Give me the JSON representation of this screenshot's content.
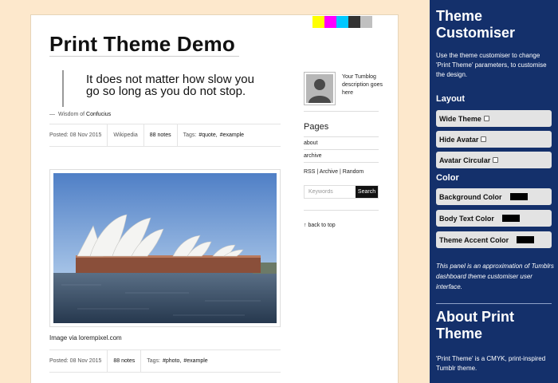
{
  "cmyk_colors": [
    "#ffff00",
    "#ff00ff",
    "#00c8ff",
    "#333333",
    "#c0c0c0"
  ],
  "site": {
    "title": "Print Theme Demo"
  },
  "post1": {
    "quote": "It does not matter how slow you go so long as you do not stop.",
    "source_prefix": "Wisdom of",
    "source_name": "Confucius",
    "posted": "Posted: 08 Nov 2015",
    "via": "Wikipedia",
    "notes": "88 notes",
    "tags_label": "Tags:",
    "tags": [
      "#quote,",
      "#example"
    ]
  },
  "post2": {
    "image_icon": "sydney-opera-house-photo",
    "caption": "Image via lorempixel.com",
    "posted": "Posted: 08 Nov 2015",
    "notes": "88 notes",
    "tags_label": "Tags:",
    "tags": [
      "#photo,",
      "#example"
    ]
  },
  "sidebar": {
    "description": "Your Tumblog description goes here",
    "pages_heading": "Pages",
    "pages": [
      "about",
      "archive"
    ],
    "util_links": [
      "RSS",
      "Archive",
      "Random"
    ],
    "search_placeholder": "Keywords",
    "search_button": "Search",
    "back_to_top": "↑ back to top"
  },
  "panel": {
    "title_line1": "Theme",
    "title_line2": "Customiser",
    "intro": "Use the theme customiser to change 'Print Theme' parameters, to customise the design.",
    "layout_heading": "Layout",
    "layout_options": [
      "Wide Theme",
      "Hide Avatar",
      "Avatar Circular"
    ],
    "color_heading": "Color",
    "color_options": [
      "Background Color",
      "Body Text Color",
      "Theme Accent Color"
    ],
    "swatch_color": "#000000",
    "note": "This panel is an approximation of Tumblrs dashboard theme customiser user interface.",
    "about_line1": "About Print",
    "about_line2": "Theme",
    "about_text": "'Print Theme' is a CMYK, print-inspired Tumblr theme."
  }
}
